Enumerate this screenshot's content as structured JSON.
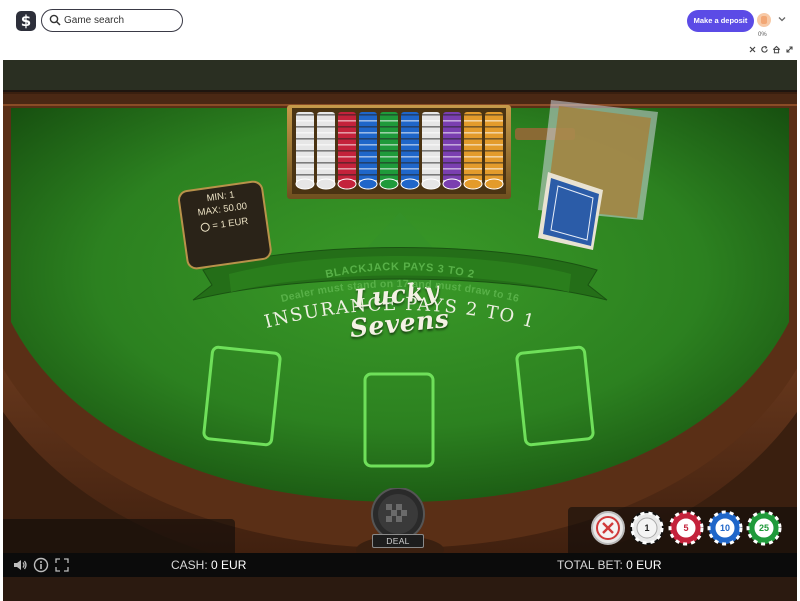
{
  "site": {
    "search": {
      "placeholder": "Game search",
      "value": ""
    },
    "deposit_label": "Make a deposit",
    "level_percent": "0%",
    "window_controls": [
      "close-icon",
      "refresh-icon",
      "home-icon",
      "expand-icon"
    ]
  },
  "table": {
    "limits": {
      "min": "MIN: 1",
      "max": "MAX: 50.00",
      "chip_value": "= 1 EUR"
    },
    "title": "Lucky Sevens",
    "rule_blackjack": "BLACKJACK PAYS 3 TO 2",
    "rule_dealer": "Dealer must stand on 17 and must draw to 16",
    "insurance": "INSURANCE PAYS 2 TO 1",
    "bet_spots": 3
  },
  "controls": {
    "deal_label": "DEAL",
    "clear_icon": "clear-bet-icon",
    "chips": [
      {
        "value": "1",
        "color": "#e8e8e8"
      },
      {
        "value": "5",
        "color": "#c4223b"
      },
      {
        "value": "10",
        "color": "#1f66c9"
      },
      {
        "value": "25",
        "color": "#1f9a3a"
      }
    ]
  },
  "status": {
    "cash_label": "CASH:",
    "cash_value": "0 EUR",
    "total_bet_label": "TOTAL BET:",
    "total_bet_value": "0 EUR"
  },
  "colors": {
    "felt": "#2f8a1f",
    "felt_dark": "#1c5612",
    "wood": "#6b3a1e",
    "accent": "#5b4be6",
    "spot_outline": "#6fe05a"
  }
}
